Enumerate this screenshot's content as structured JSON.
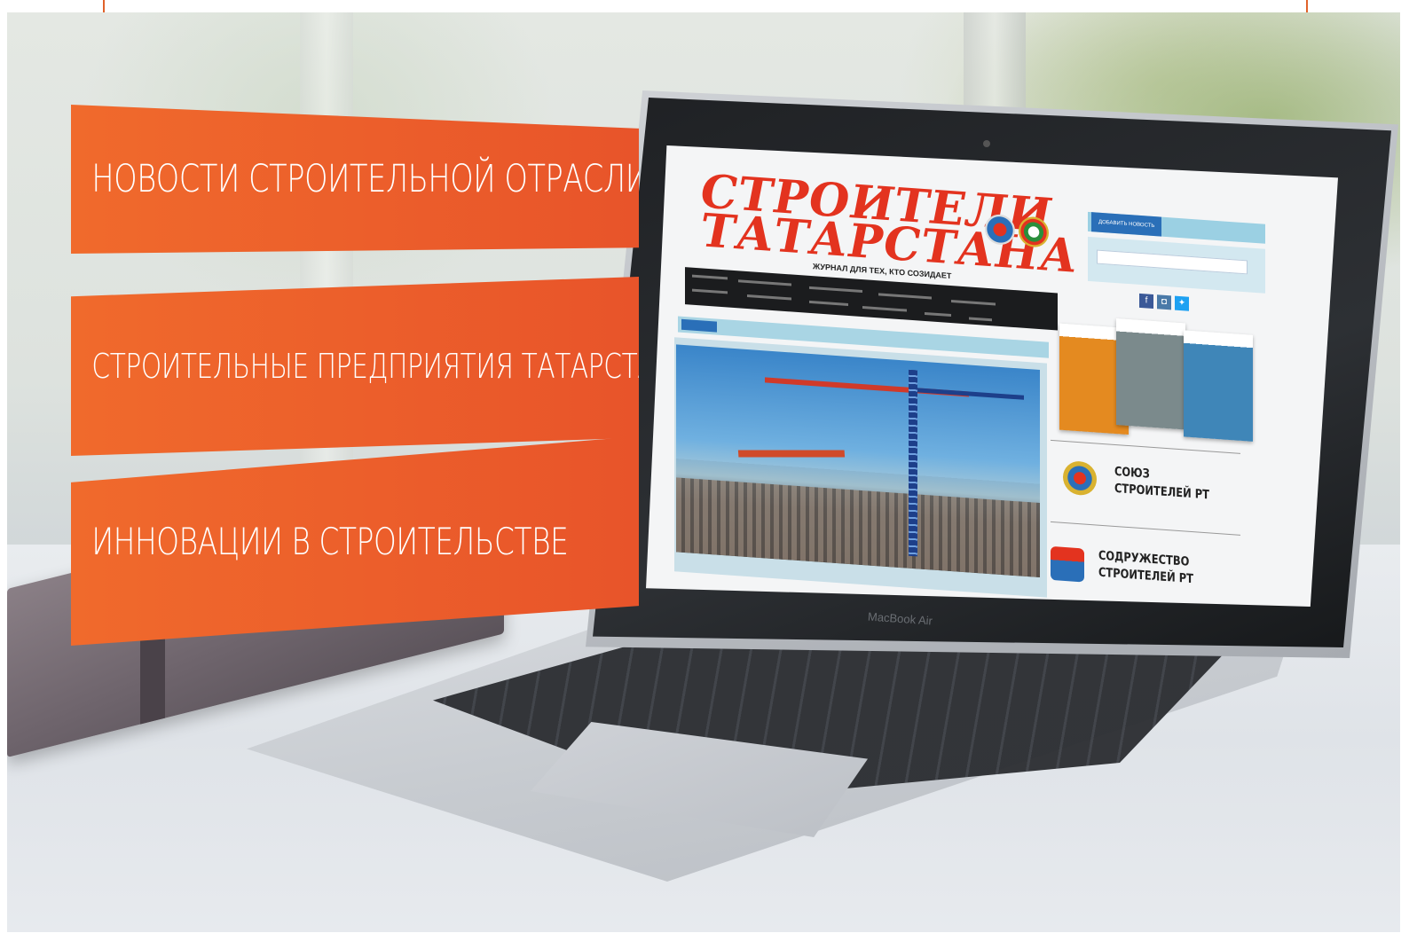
{
  "banners": [
    "НОВОСТИ СТРОИТЕЛЬНОЙ ОТРАСЛИ",
    "СТРОИТЕЛЬНЫЕ ПРЕДПРИЯТИЯ ТАТАРСТАНА",
    "ИННОВАЦИИ В СТРОИТЕЛЬСТВЕ"
  ],
  "laptop": {
    "brand": "MacBook Air"
  },
  "website": {
    "title_line1": "СТРОИТЕЛИ",
    "title_line2": "ТАТАРСТАНА",
    "tagline": "ЖУРНАЛ ДЛЯ ТЕХ, КТО СОЗИДАЕТ",
    "add_news_label": "ДОБАВИТЬ НОВОСТЬ",
    "partners": [
      {
        "line1": "СОЮЗ",
        "line2": "СТРОИТЕЛЕЙ РТ"
      },
      {
        "line1": "СОДРУЖЕСТВО",
        "line2": "СТРОИТЕЛЕЙ РТ"
      }
    ]
  },
  "colors": {
    "banner_orange": "#e8542a",
    "brand_red": "#e3331f",
    "nav_dark": "#1b1c1e",
    "accent_blue": "#2a6fb8"
  }
}
